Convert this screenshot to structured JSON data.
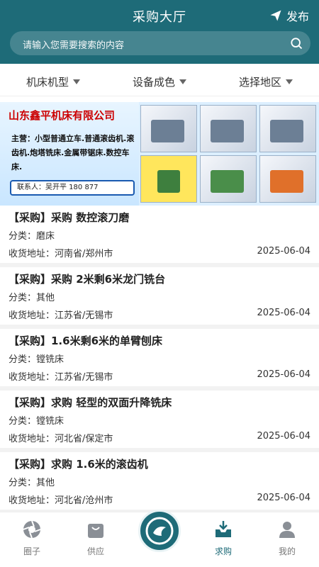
{
  "header": {
    "title": "采购大厅",
    "publish_label": "发布",
    "search_placeholder": "请输入您需要搜索的内容"
  },
  "filters": [
    {
      "label": "机床机型"
    },
    {
      "label": "设备成色"
    },
    {
      "label": "选择地区"
    }
  ],
  "banner": {
    "company": "山东鑫平机床有限公司",
    "main_business": "主营：小型普通立车.普通滚齿机.滚齿机.炮塔铣床.金属带锯床.数控车床.",
    "contact": "联系人：吴开平  180          877"
  },
  "items": [
    {
      "title": "【采购】采购  数控滚刀磨",
      "category": "分类：磨床",
      "address": "收货地址：河南省/郑州市",
      "date": "2025-06-04"
    },
    {
      "title": "【采购】采购 2米剩6米龙门铣台",
      "category": "分类：其他",
      "address": "收货地址：江苏省/无锡市",
      "date": "2025-06-04"
    },
    {
      "title": "【采购】1.6米剩6米的单臂刨床",
      "category": "分类：镗铣床",
      "address": "收货地址：江苏省/无锡市",
      "date": "2025-06-04"
    },
    {
      "title": "【采购】求购  轻型的双面升降铣床",
      "category": "分类：镗铣床",
      "address": "收货地址：河北省/保定市",
      "date": "2025-06-04"
    },
    {
      "title": "【采购】求购  1.6米的滚齿机",
      "category": "分类：其他",
      "address": "收货地址：河北省/沧州市",
      "date": "2025-06-04"
    }
  ],
  "tabs": [
    {
      "label": "圈子",
      "icon": "aperture-icon"
    },
    {
      "label": "供应",
      "icon": "shopping-bag-icon"
    },
    {
      "label": "",
      "icon": "logo-icon"
    },
    {
      "label": "求购",
      "icon": "inbox-download-icon"
    },
    {
      "label": "我的",
      "icon": "user-icon"
    }
  ],
  "colors": {
    "primary": "#1e6b78",
    "text": "#222222",
    "muted": "#777777"
  }
}
